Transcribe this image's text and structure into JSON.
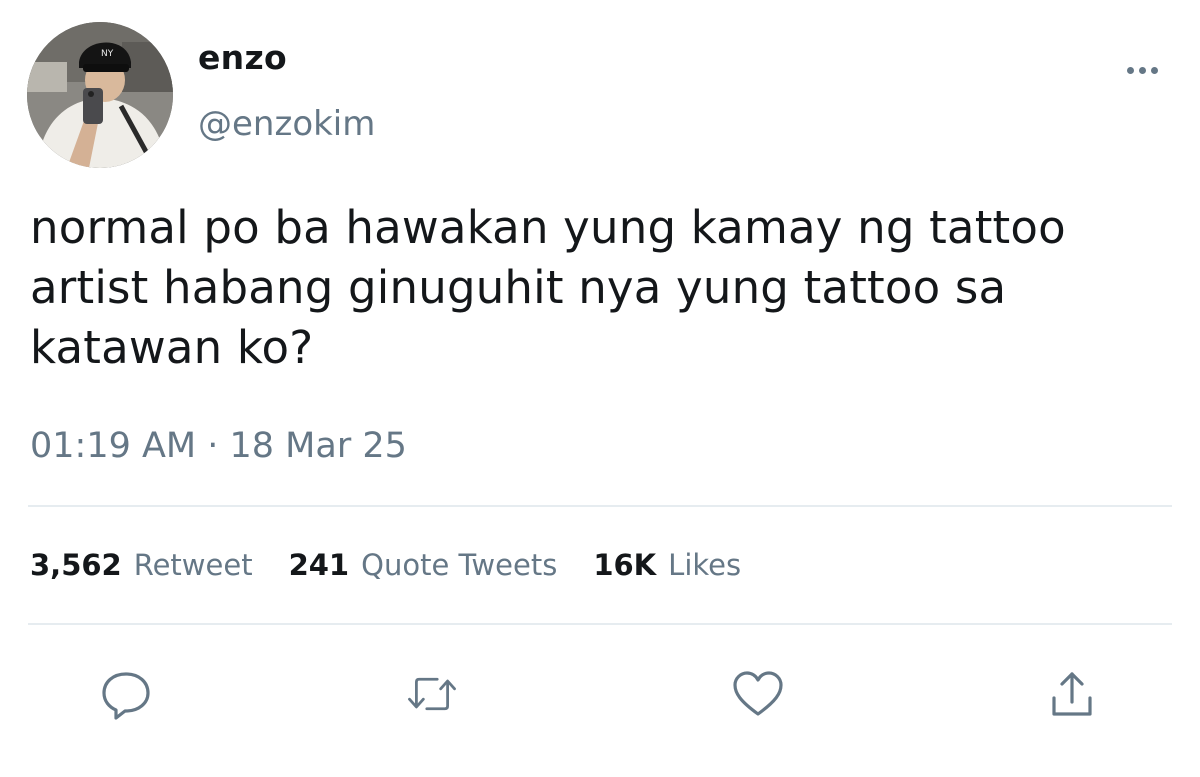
{
  "user": {
    "display_name": "enzo",
    "handle": "@enzokim",
    "avatar_icon": "profile-photo"
  },
  "more_icon": "more-horizontal-icon",
  "tweet": {
    "text": "normal po ba hawakan yung kamay ng tattoo\nartist habang ginuguhit nya yung tattoo sa\nkatawan ko?",
    "timestamp": "01:19 AM · 18 Mar 25"
  },
  "stats": {
    "retweets": {
      "count": "3,562",
      "label": "Retweet"
    },
    "quotes": {
      "count": "241",
      "label": "Quote Tweets"
    },
    "likes": {
      "count": "16K",
      "label": "Likes"
    }
  },
  "actions": {
    "reply_icon": "reply-icon",
    "retweet_icon": "retweet-icon",
    "like_icon": "heart-icon",
    "share_icon": "share-icon"
  },
  "colors": {
    "text_primary": "#14171a",
    "text_secondary": "#657786",
    "divider": "#e6ecf0"
  }
}
